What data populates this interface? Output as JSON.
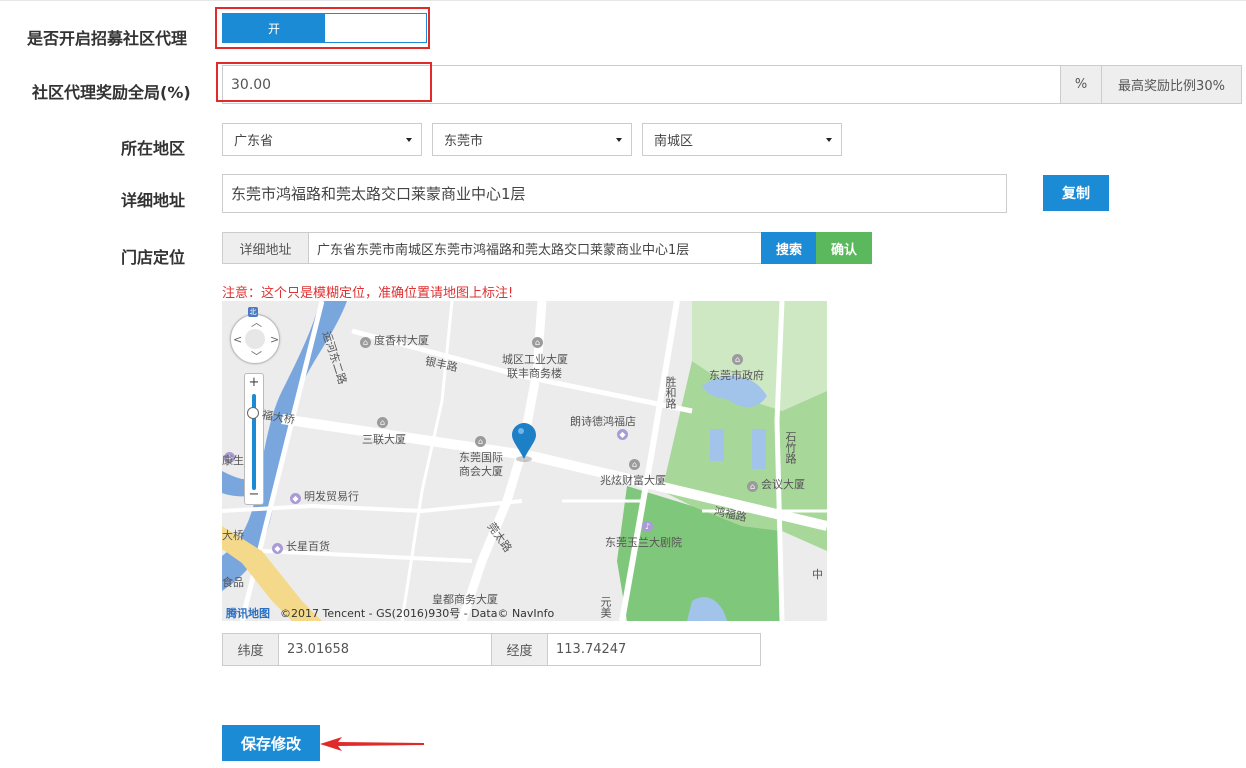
{
  "form": {
    "recruit_label": "是否开启招募社区代理",
    "toggle_on_label": "开",
    "reward_label": "社区代理奖励全局(%)",
    "reward_value": "30.00",
    "percent_addon": "%",
    "max_ratio_addon": "最高奖励比例30%",
    "region_label": "所在地区",
    "province": "广东省",
    "city": "东莞市",
    "district": "南城区",
    "address_label": "详细地址",
    "address_value": "东莞市鸿福路和莞太路交口莱蒙商业中心1层",
    "copy_button": "复制",
    "locate_label": "门店定位",
    "locate_addon": "详细地址",
    "locate_value": "广东省东莞市南城区东莞市鸿福路和莞太路交口莱蒙商业中心1层",
    "search_button": "搜索",
    "confirm_button": "确认",
    "note": "注意：这个只是模糊定位，准确位置请地图上标注!",
    "lat_label": "纬度",
    "lat_value": "23.01658",
    "lng_label": "经度",
    "lng_value": "113.74247",
    "save_button": "保存修改"
  },
  "map": {
    "labels": {
      "duxiang": "度香村大厦",
      "yunhe": "运河东二路",
      "yinfeng": "银丰路",
      "chengqu": "城区工业大厦",
      "lianfeng": "联丰商务楼",
      "zhengfu": "东莞市政府",
      "shenghe": "胜和路",
      "langshi": "朗诗德鸿福店",
      "fudaqiao": "福大桥",
      "sanlian": "三联大厦",
      "guoji1": "东莞国际",
      "guoji2": "商会大厦",
      "zhaoxuan": "兆炫财富大厦",
      "shizhu": "石竹路",
      "huiyi": "会议大厦",
      "kangsheng": "康生",
      "mingfa": "明发贸易行",
      "hongfu": "鸿福路",
      "guantai": "莞太路",
      "yulan": "东莞玉兰大剧院",
      "daqiao": "大桥",
      "changxing": "长星百货",
      "shipin": "食品",
      "huangdu": "皇都商务大厦",
      "yuanmei": "元美",
      "zhong": "中",
      "north": "北",
      "logo": "腾讯地图",
      "copyright": "©2017 Tencent - GS(2016)930号 - Data© NavInfo"
    }
  },
  "colors": {
    "primary": "#1c8bd6",
    "success": "#5cb85c",
    "danger": "#e02b2b"
  }
}
